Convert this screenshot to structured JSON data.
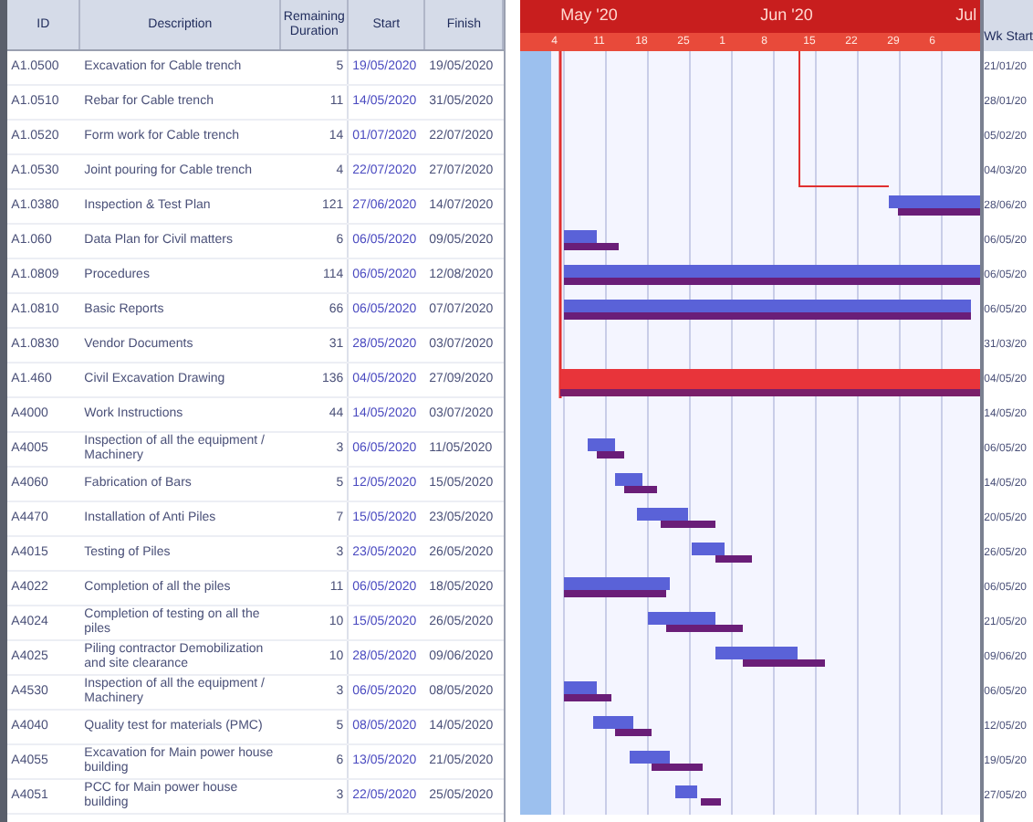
{
  "table": {
    "columns": [
      "ID",
      "Description",
      "Remaining Duration",
      "Start",
      "Finish",
      "Wk Start"
    ],
    "rows": [
      {
        "id": "A1.0500",
        "description": "Excavation for Cable trench",
        "remaining": "5",
        "start": "19/05/2020",
        "finish": "19/05/2020",
        "column_6": "21/01/20"
      },
      {
        "id": "A1.0510",
        "description": "Rebar for Cable trench",
        "remaining": "11",
        "start": "14/05/2020",
        "finish": "31/05/2020",
        "column_6": "28/01/20"
      },
      {
        "id": "A1.0520",
        "description": "Form work for Cable trench",
        "remaining": "14",
        "start": "01/07/2020",
        "finish": "22/07/2020",
        "column_6": "05/02/20"
      },
      {
        "id": "A1.0530",
        "description": "Joint pouring for Cable trench",
        "remaining": "4",
        "start": "22/07/2020",
        "finish": "27/07/2020",
        "column_6": "04/03/20"
      },
      {
        "id": "A1.0380",
        "description": "Inspection & Test Plan",
        "remaining": "121",
        "start": "27/06/2020",
        "finish": "14/07/2020",
        "column_6": "28/06/20"
      },
      {
        "id": "A1.060",
        "description": "Data Plan for Civil matters",
        "remaining": "6",
        "start": "06/05/2020",
        "finish": "09/05/2020",
        "column_6": "06/05/20"
      },
      {
        "id": "A1.0809",
        "description": "Procedures",
        "remaining": "114",
        "start": "06/05/2020",
        "finish": "12/08/2020",
        "column_6": "06/05/20"
      },
      {
        "id": "A1.0810",
        "description": "Basic Reports",
        "remaining": "66",
        "start": "06/05/2020",
        "finish": "07/07/2020",
        "column_6": "06/05/20"
      },
      {
        "id": "A1.0830",
        "description": "Vendor Documents",
        "remaining": "31",
        "start": "28/05/2020",
        "finish": "03/07/2020",
        "column_6": "31/03/20"
      },
      {
        "id": "A1.460",
        "description": "Civil Excavation Drawing",
        "remaining": "136",
        "start": "04/05/2020",
        "finish": "27/09/2020",
        "column_6": "04/05/20"
      },
      {
        "id": "A4000",
        "description": "Work Instructions",
        "remaining": "44",
        "start": "14/05/2020",
        "finish": "03/07/2020",
        "column_6": "14/05/20"
      },
      {
        "id": "A4005",
        "description": "Inspection of all the equipment / Machinery",
        "remaining": "3",
        "start": "06/05/2020",
        "finish": "11/05/2020",
        "column_6": "06/05/20"
      },
      {
        "id": "A4060",
        "description": "Fabrication of Bars",
        "remaining": "5",
        "start": "12/05/2020",
        "finish": "15/05/2020",
        "column_6": "14/05/20"
      },
      {
        "id": "A4470",
        "description": "Installation of Anti Piles",
        "remaining": "7",
        "start": "15/05/2020",
        "finish": "23/05/2020",
        "column_6": "20/05/20"
      },
      {
        "id": "A4015",
        "description": "Testing of Piles",
        "remaining": "3",
        "start": "23/05/2020",
        "finish": "26/05/2020",
        "column_6": "26/05/20"
      },
      {
        "id": "A4022",
        "description": "Completion of all the piles",
        "remaining": "11",
        "start": "06/05/2020",
        "finish": "18/05/2020",
        "column_6": "06/05/20"
      },
      {
        "id": "A4024",
        "description": "Completion of testing on all the piles",
        "remaining": "10",
        "start": "15/05/2020",
        "finish": "26/05/2020",
        "column_6": "21/05/20"
      },
      {
        "id": "A4025",
        "description": "Piling contractor Demobilization and site clearance",
        "remaining": "10",
        "start": "28/05/2020",
        "finish": "09/06/2020",
        "column_6": "09/06/20"
      },
      {
        "id": "A4530",
        "description": "Inspection of all the equipment / Machinery",
        "remaining": "3",
        "start": "06/05/2020",
        "finish": "08/05/2020",
        "column_6": "06/05/20"
      },
      {
        "id": "A4040",
        "description": "Quality test for materials (PMC)",
        "remaining": "5",
        "start": "08/05/2020",
        "finish": "14/05/2020",
        "column_6": "12/05/20"
      },
      {
        "id": "A4055",
        "description": "Excavation for Main power house building",
        "remaining": "6",
        "start": "13/05/2020",
        "finish": "21/05/2020",
        "column_6": "19/05/20"
      },
      {
        "id": "A4051",
        "description": "PCC for Main power house building",
        "remaining": "3",
        "start": "22/05/2020",
        "finish": "25/05/2020",
        "column_6": "27/05/20"
      }
    ]
  },
  "gantt": {
    "months": [
      "May '20",
      "Jun '20",
      "Jul"
    ],
    "days": [
      "4",
      "11",
      "18",
      "25",
      "1",
      "8",
      "15",
      "22",
      "29",
      "6"
    ]
  }
}
